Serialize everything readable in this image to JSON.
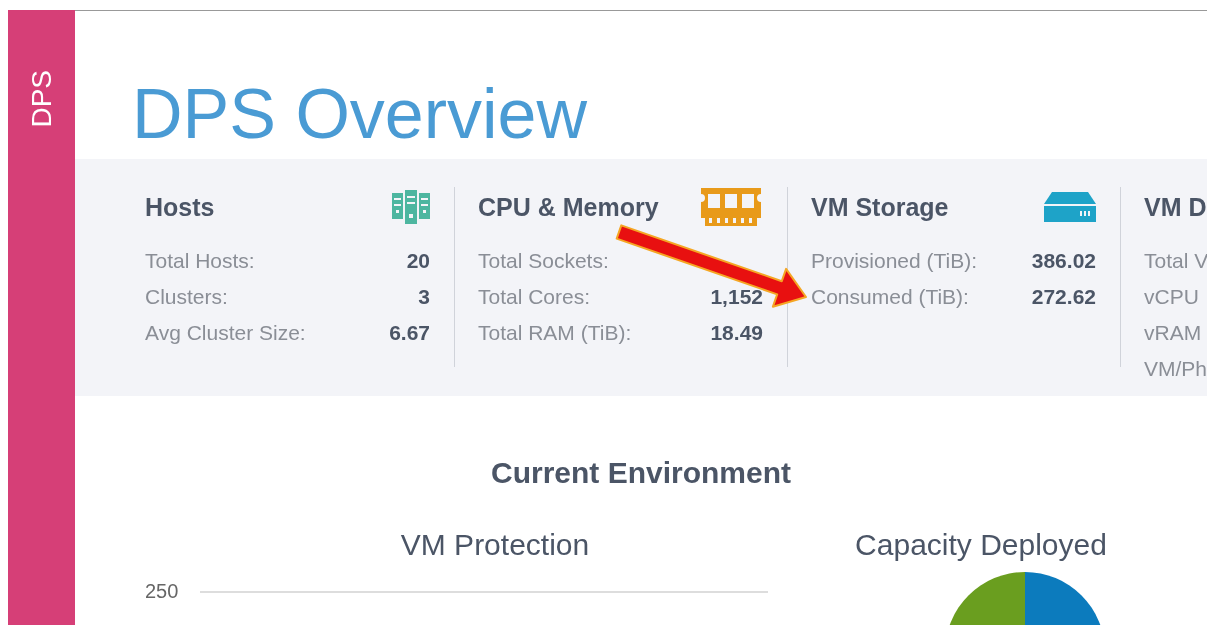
{
  "sidebar": {
    "label": "DPS"
  },
  "title": "DPS Overview",
  "summary": [
    {
      "heading": "Hosts",
      "rows": [
        {
          "label": "Total Hosts:",
          "value": "20"
        },
        {
          "label": "Clusters:",
          "value": "3"
        },
        {
          "label": "Avg Cluster Size:",
          "value": "6.67"
        }
      ]
    },
    {
      "heading": "CPU & Memory",
      "rows": [
        {
          "label": "Total Sockets:"
        },
        {
          "label": "Total Cores:",
          "value": "1,152"
        },
        {
          "label": "Total RAM (TiB):",
          "value": "18.49"
        }
      ]
    },
    {
      "heading": "VM Storage",
      "rows": [
        {
          "label": "Provisioned (TiB):",
          "value": "386.02"
        },
        {
          "label": "Consumed (TiB):",
          "value": "272.62"
        }
      ]
    },
    {
      "heading": "VM D",
      "rows": [
        {
          "label": "Total V"
        },
        {
          "label": "vCPU"
        },
        {
          "label": "vRAM"
        },
        {
          "label": "VM/Ph"
        }
      ]
    }
  ],
  "section_title": "Current Environment",
  "charts": [
    {
      "title": "VM Protection",
      "y_tick": "250"
    },
    {
      "title": "Capacity Deployed"
    }
  ]
}
